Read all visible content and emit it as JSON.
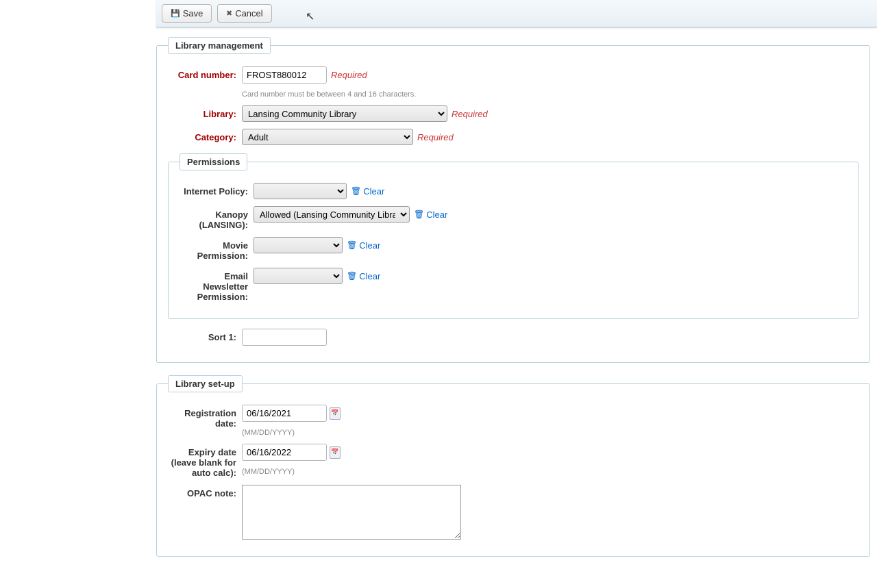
{
  "toolbar": {
    "save_label": "Save",
    "cancel_label": "Cancel"
  },
  "sections": {
    "library_management": {
      "legend": "Library management",
      "card_number": {
        "label": "Card number:",
        "value": "FROST880012",
        "required": "Required",
        "hint": "Card number must be between 4 and 16 characters."
      },
      "library": {
        "label": "Library:",
        "value": "Lansing Community Library",
        "required": "Required"
      },
      "category": {
        "label": "Category:",
        "value": "Adult",
        "required": "Required"
      },
      "sort1": {
        "label": "Sort 1:",
        "value": ""
      }
    },
    "permissions": {
      "legend": "Permissions",
      "internet_policy": {
        "label": "Internet Policy:",
        "value": "",
        "clear": "Clear"
      },
      "kanopy": {
        "label": "Kanopy (LANSING):",
        "value": "Allowed (Lansing Community Library)",
        "clear": "Clear"
      },
      "movie": {
        "label": "Movie Permission:",
        "value": "",
        "clear": "Clear"
      },
      "email_news": {
        "label": "Email Newsletter Permission:",
        "value": "",
        "clear": "Clear"
      }
    },
    "library_setup": {
      "legend": "Library set-up",
      "registration_date": {
        "label": "Registration date:",
        "value": "06/16/2021",
        "hint": "(MM/DD/YYYY)"
      },
      "expiry_date": {
        "label": "Expiry date (leave blank for auto calc):",
        "value": "06/16/2022",
        "hint": "(MM/DD/YYYY)"
      },
      "opac_note": {
        "label": "OPAC note:",
        "value": ""
      }
    }
  }
}
